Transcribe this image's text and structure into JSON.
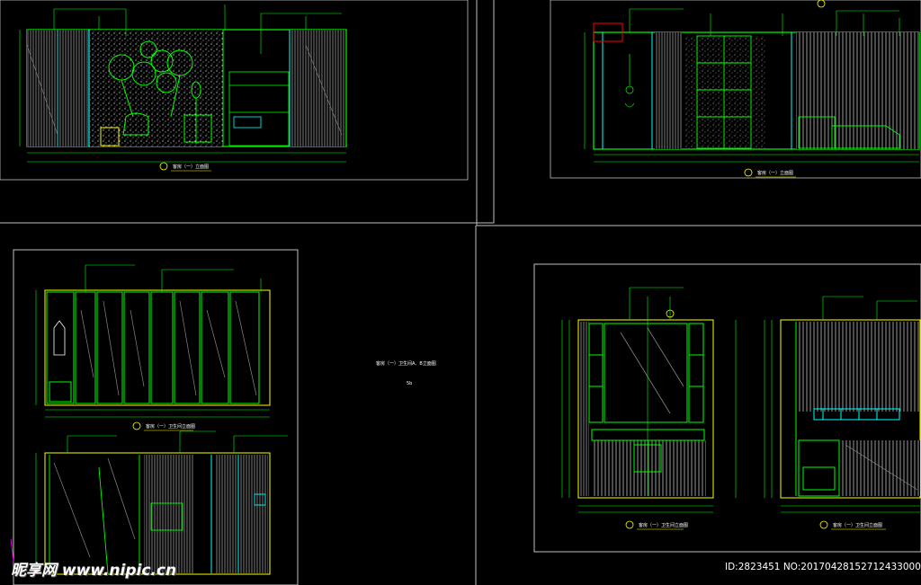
{
  "watermark": {
    "site": "昵享网 www.nipic.cn",
    "id_line": "ID:2823451 NO:20170428152712433000"
  },
  "drawings": {
    "top_left_title": "客房（一）立面图",
    "top_right_title": "客房（一）立面图",
    "mid_left_title": "客房（一）卫生间立面图",
    "center_note": "客房（一）卫生间A、B立面图",
    "center_note_small": "5b",
    "bottom_right_title_a": "客房（一）卫生间立面图",
    "bottom_right_title_b": "客房（一）卫生间立面图"
  },
  "colors": {
    "background": "#000000",
    "frame": "#bfbfbf",
    "line_green": "#00ff00",
    "line_yellow": "#ffff00",
    "line_cyan": "#00ffff",
    "line_white": "#ffffff",
    "line_magenta": "#ff00ff",
    "highlight_red": "#ff0000"
  }
}
